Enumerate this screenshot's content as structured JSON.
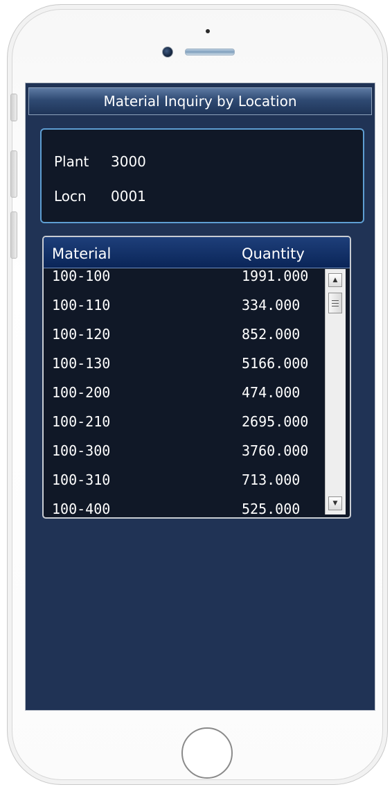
{
  "app": {
    "title": "Material Inquiry by Location"
  },
  "info": {
    "plant_label": "Plant",
    "plant_value": "3000",
    "locn_label": "Locn",
    "locn_value": "0001"
  },
  "list": {
    "headers": {
      "material": "Material",
      "quantity": "Quantity"
    },
    "rows": [
      {
        "material": "100-100",
        "quantity": "1991.000"
      },
      {
        "material": "100-110",
        "quantity": "334.000"
      },
      {
        "material": "100-120",
        "quantity": "852.000"
      },
      {
        "material": "100-130",
        "quantity": "5166.000"
      },
      {
        "material": "100-200",
        "quantity": "474.000"
      },
      {
        "material": "100-210",
        "quantity": "2695.000"
      },
      {
        "material": "100-300",
        "quantity": "3760.000"
      },
      {
        "material": "100-310",
        "quantity": "713.000"
      },
      {
        "material": "100-400",
        "quantity": "525.000"
      }
    ]
  },
  "icons": {
    "scroll_up": "scroll-up-arrow-icon",
    "scroll_down": "scroll-down-arrow-icon"
  },
  "colors": {
    "screen_background": "#203355",
    "panel_background": "#101827",
    "panel_border": "#5e9ed2",
    "header_background": "#0a2558",
    "text": "#ffffff"
  }
}
